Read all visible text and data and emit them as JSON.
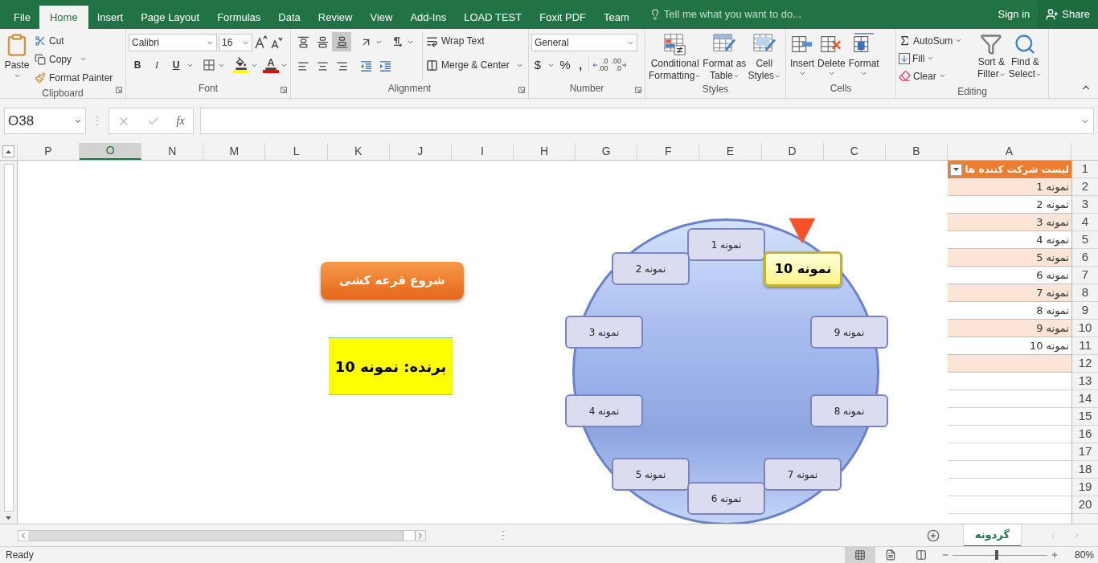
{
  "ribbon_tabs": [
    {
      "label": "Team",
      "selected": false
    },
    {
      "label": "Foxit PDF",
      "selected": false
    },
    {
      "label": "LOAD TEST",
      "selected": false
    },
    {
      "label": "Add-Ins",
      "selected": false
    },
    {
      "label": "View",
      "selected": false
    },
    {
      "label": "Review",
      "selected": false
    },
    {
      "label": "Data",
      "selected": false
    },
    {
      "label": "Formulas",
      "selected": false
    },
    {
      "label": "Page Layout",
      "selected": false
    },
    {
      "label": "Insert",
      "selected": false
    },
    {
      "label": "Home",
      "selected": true
    },
    {
      "label": "File",
      "selected": false
    }
  ],
  "tell_me": {
    "placeholder": "Tell me what you want to do..."
  },
  "sign_in": "Sign in",
  "share": "Share",
  "clipboard": {
    "title": "Clipboard",
    "paste": "Paste",
    "cut": "Cut",
    "copy": "Copy",
    "format_painter": "Format Painter"
  },
  "font": {
    "title": "Font",
    "name": "Calibri",
    "size": "16",
    "bold": "B",
    "italic": "I",
    "underline": "U"
  },
  "alignment": {
    "title": "Alignment",
    "wrap_text": "Wrap Text",
    "merge_center": "Merge & Center"
  },
  "number": {
    "title": "Number",
    "format": "General",
    "currency": "$",
    "percent": "%",
    "comma": ",",
    "increase_decimal": [
      ".0",
      ".00"
    ],
    "decrease_decimal": [
      ".00",
      ".0"
    ]
  },
  "styles": {
    "title": "Styles",
    "buttons": [
      {
        "kind": "cell",
        "lines": [
          "Cell",
          "Styles"
        ]
      },
      {
        "kind": "table",
        "lines": [
          "Format as",
          "Table"
        ]
      },
      {
        "kind": "conditional",
        "lines": [
          "Conditional",
          "Formatting"
        ]
      }
    ]
  },
  "cells": {
    "title": "Cells",
    "buttons": [
      {
        "kind": "format",
        "label": "Format"
      },
      {
        "kind": "delete",
        "label": "Delete"
      },
      {
        "kind": "insert",
        "label": "Insert"
      }
    ]
  },
  "editing": {
    "title": "Editing",
    "autosum": "AutoSum",
    "fill": "Fill",
    "clear": "Clear",
    "sort_filter": [
      "Sort &",
      "Filter"
    ],
    "find_select": [
      "Find &",
      "Select"
    ]
  },
  "formula_bar": {
    "name_box": "O38",
    "function_label": "fx"
  },
  "columns": [
    {
      "label": "A",
      "selected": false
    },
    {
      "label": "B",
      "selected": false
    },
    {
      "label": "C",
      "selected": false
    },
    {
      "label": "D",
      "selected": false
    },
    {
      "label": "E",
      "selected": false
    },
    {
      "label": "F",
      "selected": false
    },
    {
      "label": "G",
      "selected": false
    },
    {
      "label": "H",
      "selected": false
    },
    {
      "label": "I",
      "selected": false
    },
    {
      "label": "J",
      "selected": false
    },
    {
      "label": "K",
      "selected": false
    },
    {
      "label": "L",
      "selected": false
    },
    {
      "label": "M",
      "selected": false
    },
    {
      "label": "N",
      "selected": false
    },
    {
      "label": "O",
      "selected": true
    },
    {
      "label": "P",
      "selected": false
    }
  ],
  "row_numbers": [
    "1",
    "2",
    "3",
    "4",
    "5",
    "6",
    "7",
    "8",
    "9",
    "10",
    "11",
    "12",
    "13",
    "14",
    "15",
    "16",
    "17",
    "18",
    "19",
    "20"
  ],
  "participants": {
    "header": "لیست شرکت کننده ها",
    "items": [
      "نمونه 1",
      "نمونه 2",
      "نمونه 3",
      "نمونه 4",
      "نمونه 5",
      "نمونه 6",
      "نمونه 7",
      "نمونه 8",
      "نمونه 9",
      "نمونه 10"
    ]
  },
  "draw_button": "شروع قرعه کشی",
  "winner": "برنده: نمونه 10",
  "wheel": [
    {
      "label": "نمونه 1",
      "selected": false
    },
    {
      "label": "نمونه 2",
      "selected": false
    },
    {
      "label": "نمونه 3",
      "selected": false
    },
    {
      "label": "نمونه 4",
      "selected": false
    },
    {
      "label": "نمونه 5",
      "selected": false
    },
    {
      "label": "نمونه 6",
      "selected": false
    },
    {
      "label": "نمونه 7",
      "selected": false
    },
    {
      "label": "نمونه 8",
      "selected": false
    },
    {
      "label": "نمونه 9",
      "selected": false
    },
    {
      "label": "نمونه 10",
      "selected": true
    }
  ],
  "sheet_tabs": [
    {
      "label": "گردونه",
      "selected": true
    }
  ],
  "status": {
    "text": "Ready",
    "zoom": "80%",
    "zoom_slider": {
      "level": 0.47
    }
  },
  "views": [
    {
      "kind": "normal",
      "selected": true
    },
    {
      "kind": "page_layout",
      "selected": false
    },
    {
      "kind": "page_break",
      "selected": false
    }
  ]
}
